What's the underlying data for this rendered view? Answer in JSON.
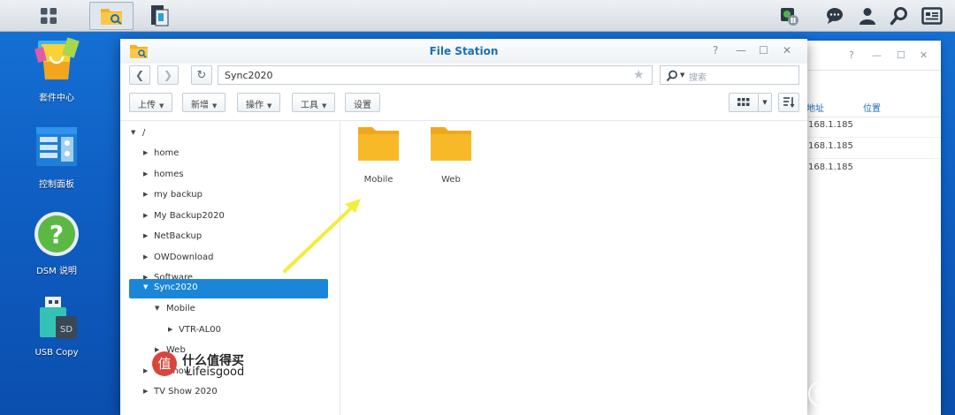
{
  "window": {
    "title": "File Station",
    "path": "Sync2020",
    "search_placeholder": "搜索",
    "controls": [
      "?",
      "—",
      "☐",
      "✕"
    ]
  },
  "toolbar": {
    "upload": "上传",
    "new": "新增",
    "action": "操作",
    "tools": "工具",
    "settings": "设置"
  },
  "desktop": {
    "package_center": "套件中心",
    "control_panel": "控制面板",
    "dsm_help": "DSM 说明",
    "usb_copy": "USB Copy",
    "sd_label": "SD"
  },
  "tree": {
    "root": "/",
    "items": [
      {
        "label": "home"
      },
      {
        "label": "homes"
      },
      {
        "label": "my backup"
      },
      {
        "label": "My Backup2020"
      },
      {
        "label": "NetBackup"
      },
      {
        "label": "OWDownload"
      },
      {
        "label": "Software"
      },
      {
        "label": "Sync2020"
      },
      {
        "label": "Mobile"
      },
      {
        "label": "VTR-AL00"
      },
      {
        "label": "Web"
      },
      {
        "label": "TV show"
      },
      {
        "label": "TV Show 2020"
      }
    ]
  },
  "content": {
    "folders": [
      {
        "name": "Mobile"
      },
      {
        "name": "Web"
      }
    ]
  },
  "background_window": {
    "col_address": "地址",
    "col_location": "位置",
    "rows": [
      "168.1.185",
      "168.1.185",
      "168.1.185"
    ]
  },
  "watermark": {
    "site": "什么值得买",
    "user": "Lifeisgood",
    "badge": "值",
    "corner": "什么值得买"
  },
  "colors": {
    "accent": "#1b86d8",
    "folder": "#f6b31f",
    "desktop": "#0f5fc4"
  }
}
